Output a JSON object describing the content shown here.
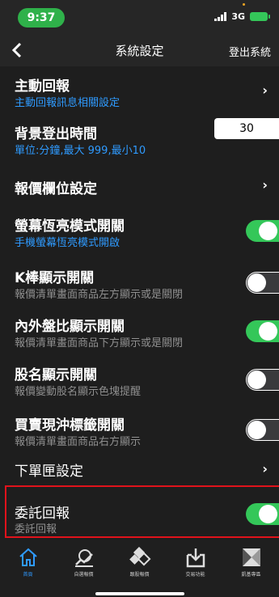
{
  "status": {
    "time": "9:37",
    "network": "3G"
  },
  "nav": {
    "back_icon": "chevron-left-icon",
    "title": "系統設定",
    "logout_label": "登出系統"
  },
  "rows": [
    {
      "title": "主動回報",
      "subtitle": "主動回報訊息相關設定",
      "control": "chevron"
    },
    {
      "title": "背景登出時間",
      "subtitle": "單位:分鐘,最大 999,最小10",
      "control": "input",
      "value": "30"
    },
    {
      "title": "報價欄位設定",
      "control": "chevron"
    },
    {
      "title": "螢幕恆亮模式開關",
      "subtitle": "手機螢幕恆亮模式開啟",
      "control": "toggle",
      "on": true
    },
    {
      "title": "K棒顯示開關",
      "subtitle": "報價清單畫面商品左方顯示或是關閉",
      "control": "toggle",
      "on": false
    },
    {
      "title": "內外盤比顯示開關",
      "subtitle": "報價清單畫面商品下方顯示或是關閉",
      "control": "toggle",
      "on": true
    },
    {
      "title": "股名顯示開關",
      "subtitle": "報價變動股名顯示色塊提醒",
      "control": "toggle",
      "on": false
    },
    {
      "title": "買賣現沖標籤開關",
      "subtitle": "報價清單畫面商品右方顯示",
      "control": "toggle",
      "on": false
    },
    {
      "title": "下單匣設定",
      "control": "chevron"
    },
    {
      "title": "委託回報",
      "subtitle": "委託回報",
      "control": "toggle",
      "on": true
    }
  ],
  "tabs": [
    {
      "label": "首頁",
      "icon": "home-icon",
      "active": true
    },
    {
      "label": "自選報價",
      "icon": "watchlist-icon",
      "active": false
    },
    {
      "label": "跟股報價",
      "icon": "diamond-grid-icon",
      "active": false
    },
    {
      "label": "交易功能",
      "icon": "trade-download-icon",
      "active": false
    },
    {
      "label": "凱基專區",
      "icon": "kgi-zone-icon",
      "active": false
    }
  ],
  "colors": {
    "accent_blue": "#2f9bff",
    "toggle_green": "#34c759",
    "highlight_red": "#e0121b",
    "background": "#1e1e1e"
  }
}
